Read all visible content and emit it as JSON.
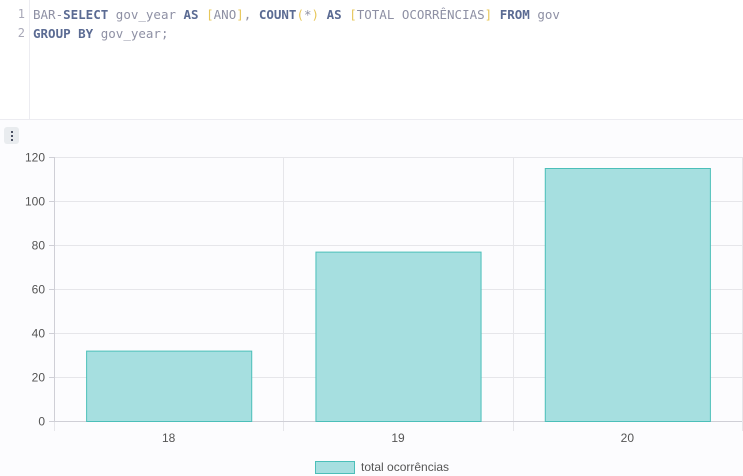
{
  "editor": {
    "line_numbers": [
      "1",
      "2"
    ],
    "line1": {
      "prefix": "BAR-",
      "kw_select": "SELECT",
      "field": " gov_year ",
      "kw_as1": "AS",
      "sp1": " ",
      "br_open1": "[",
      "alias1": "ANO",
      "br_close1": "]",
      "comma": ", ",
      "kw_count": "COUNT",
      "paren_open": "(",
      "star": "*",
      "paren_close": ")",
      "sp2": " ",
      "kw_as2": "AS",
      "sp3": " ",
      "br_open2": "[",
      "alias2": "TOTAL OCORRÊNCIAS",
      "br_close2": "]",
      "sp4": " ",
      "kw_from": "FROM",
      "table": " gov"
    },
    "line2": {
      "kw_group": "GROUP BY",
      "rest": " gov_year;"
    }
  },
  "colors": {
    "bar_fill": "#a6dfe0",
    "bar_stroke": "#4bbfb9",
    "keyword": "#5b6b93",
    "bracket": "#e7c75a"
  },
  "chart_data": {
    "type": "bar",
    "categories": [
      "18",
      "19",
      "20"
    ],
    "series": [
      {
        "name": "total ocorrências",
        "values": [
          32,
          77,
          115
        ]
      }
    ],
    "ylim": [
      0,
      120
    ],
    "yticks": [
      "0",
      "20",
      "40",
      "60",
      "80",
      "100",
      "120"
    ],
    "grid": true,
    "legend": "bottom-center"
  }
}
